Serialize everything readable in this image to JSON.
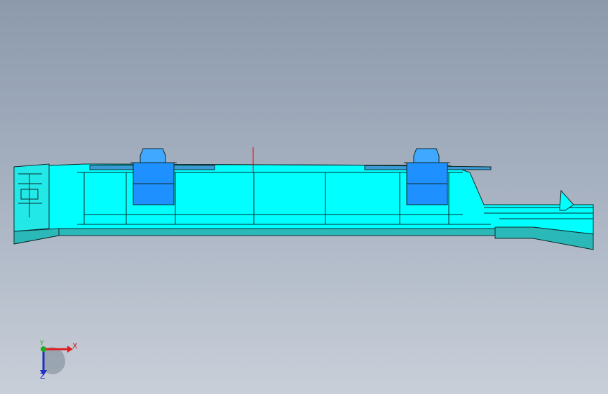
{
  "viewport": {
    "background_top": "#8c9aac",
    "background_bottom": "#c9cfd9"
  },
  "model": {
    "body_color": "#00ffff",
    "shade_color": "#2ab8b8",
    "clip_color": "#1e90ff",
    "edge_color": "#102a2a",
    "origin_marker_color": "#ff0000"
  },
  "triad": {
    "x_label": "X",
    "y_label": "Y",
    "z_label": "Z",
    "x_color": "#e02020",
    "y_color": "#22aa22",
    "z_color": "#2030c0"
  }
}
